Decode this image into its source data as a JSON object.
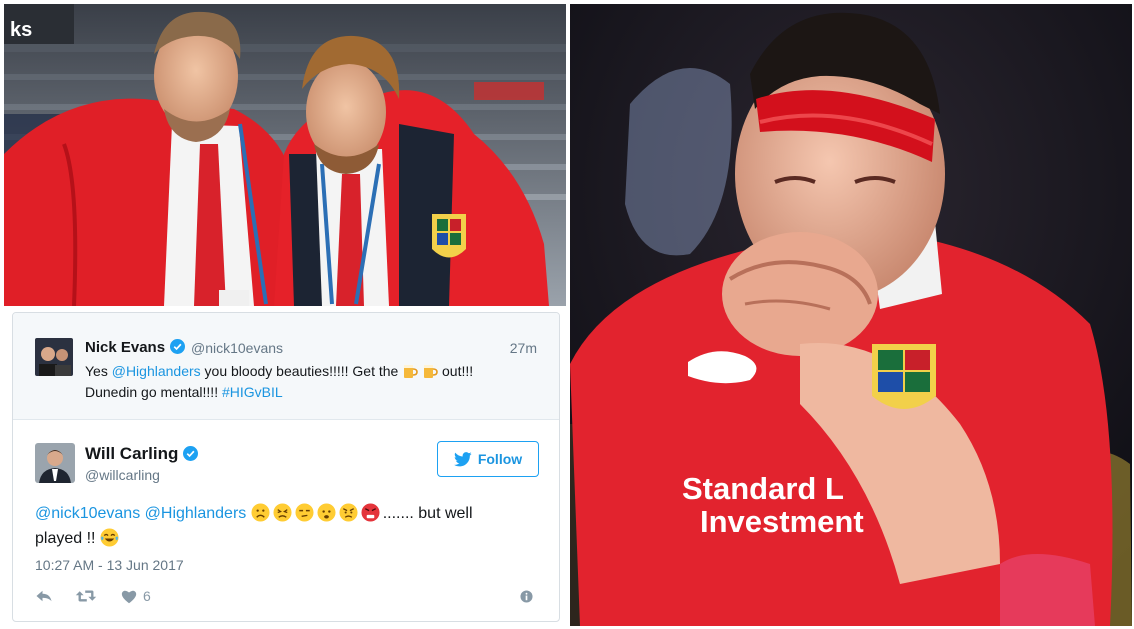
{
  "quoted_tweet": {
    "author_name": "Nick Evans",
    "handle": "@nick10evans",
    "time": "27m",
    "text_start": "Yes ",
    "mention": "@Highlanders",
    "text_mid": " you bloody beauties!!!!! Get the ",
    "text_after_beer": " out!!!",
    "text_line2": "Dunedin go mental!!!! ",
    "hashtag": "#HIGvBIL"
  },
  "main_tweet": {
    "author_name": "Will Carling",
    "handle": "@willcarling",
    "follow_label": "Follow",
    "mention_1": "@nick10evans",
    "mention_2": "@Highlanders",
    "text_after_emojis": "....... but well",
    "text_line2": "played !! ",
    "timestamp": "10:27 AM - 13 Jun 2017",
    "like_count": "6"
  },
  "photos": {
    "left_jersey_text": "ks",
    "right_sponsor_line1": "Standard L",
    "right_sponsor_line2": "Investment"
  },
  "colors": {
    "lions_red": "#e8202a",
    "twitter_blue": "#1da1f2",
    "link_blue": "#1b95e0",
    "muted_gray": "#657786"
  }
}
